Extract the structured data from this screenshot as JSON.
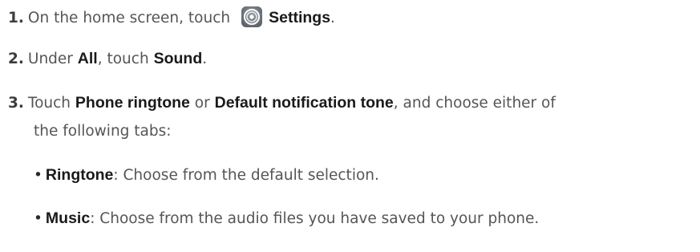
{
  "steps": [
    {
      "number": "1.",
      "text_before": "On the home screen, touch",
      "icon": "settings-gear-icon",
      "bold_1": "Settings",
      "text_after": "."
    },
    {
      "number": "2.",
      "text_1": "Under",
      "bold_1": "All",
      "text_2": ", touch",
      "bold_2": "Sound",
      "text_3": "."
    },
    {
      "number": "3.",
      "text_1": "Touch",
      "bold_1": "Phone ringtone",
      "text_2": "or",
      "bold_2": "Default notification tone",
      "text_3": ", and choose either of",
      "continuation": "the following tabs:"
    }
  ],
  "bullets": [
    {
      "symbol": "•",
      "bold": "Ringtone",
      "text": ": Choose from the default selection."
    },
    {
      "symbol": "•",
      "bold": "Music",
      "text": ": Choose from the audio files you have saved to your phone."
    }
  ]
}
